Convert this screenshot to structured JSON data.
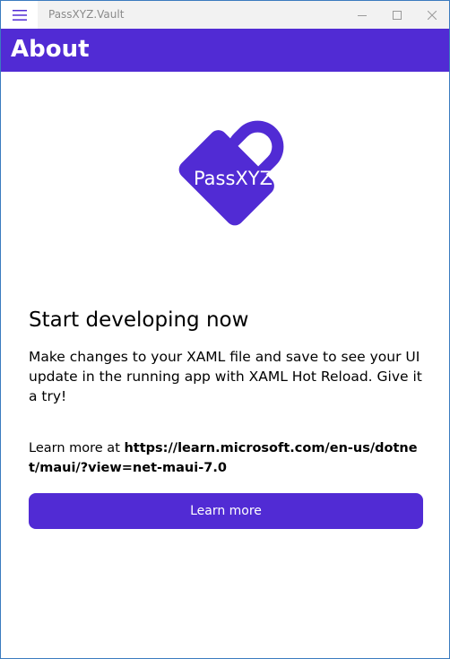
{
  "window": {
    "title": "PassXYZ.Vault",
    "icons": {
      "menu": "hamburger-menu-icon",
      "minimize": "minimize-icon",
      "maximize": "maximize-icon",
      "close": "close-icon"
    }
  },
  "header": {
    "title": "About",
    "color": "#512bd4"
  },
  "main": {
    "logo": {
      "text": "PassXYZ",
      "icon": "padlock-logo-icon",
      "color": "#512bd4"
    },
    "heading": "Start developing now",
    "description": "Make changes to your XAML file and save to see your UI update in the running app with XAML Hot Reload. Give it a try!",
    "learn_more_prefix": "Learn more at ",
    "learn_more_url": "https://learn.microsoft.com/en-us/dotnet/maui/?view=net-maui-7.0",
    "button_label": "Learn more",
    "accent_color": "#512bd4"
  }
}
